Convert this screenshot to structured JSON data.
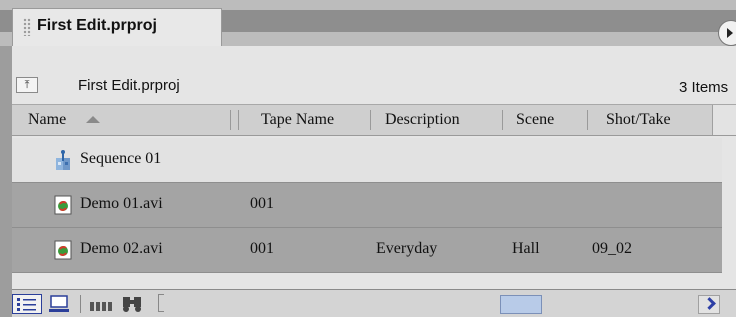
{
  "tab": {
    "title": "First Edit.prproj"
  },
  "info": {
    "project_name": "First Edit.prproj",
    "item_count": "3 Items"
  },
  "columns": [
    "Name",
    "Tape Name",
    "Description",
    "Scene",
    "Shot/Take"
  ],
  "rows": [
    {
      "name": "Sequence 01",
      "icon": "sequence-icon",
      "tape_name": "",
      "description": "",
      "scene": "",
      "shot_take": ""
    },
    {
      "name": "Demo 01.avi",
      "icon": "avi-file-icon",
      "tape_name": "001",
      "description": "",
      "scene": "",
      "shot_take": ""
    },
    {
      "name": "Demo 02.avi",
      "icon": "avi-file-icon",
      "tape_name": "001",
      "description": "Everyday",
      "scene": "Hall",
      "shot_take": "09_02"
    }
  ],
  "bottom_toolbar": {
    "icons": [
      "list-view-icon",
      "icon-view-icon",
      "automate-to-sequence-icon",
      "find-icon"
    ]
  }
}
